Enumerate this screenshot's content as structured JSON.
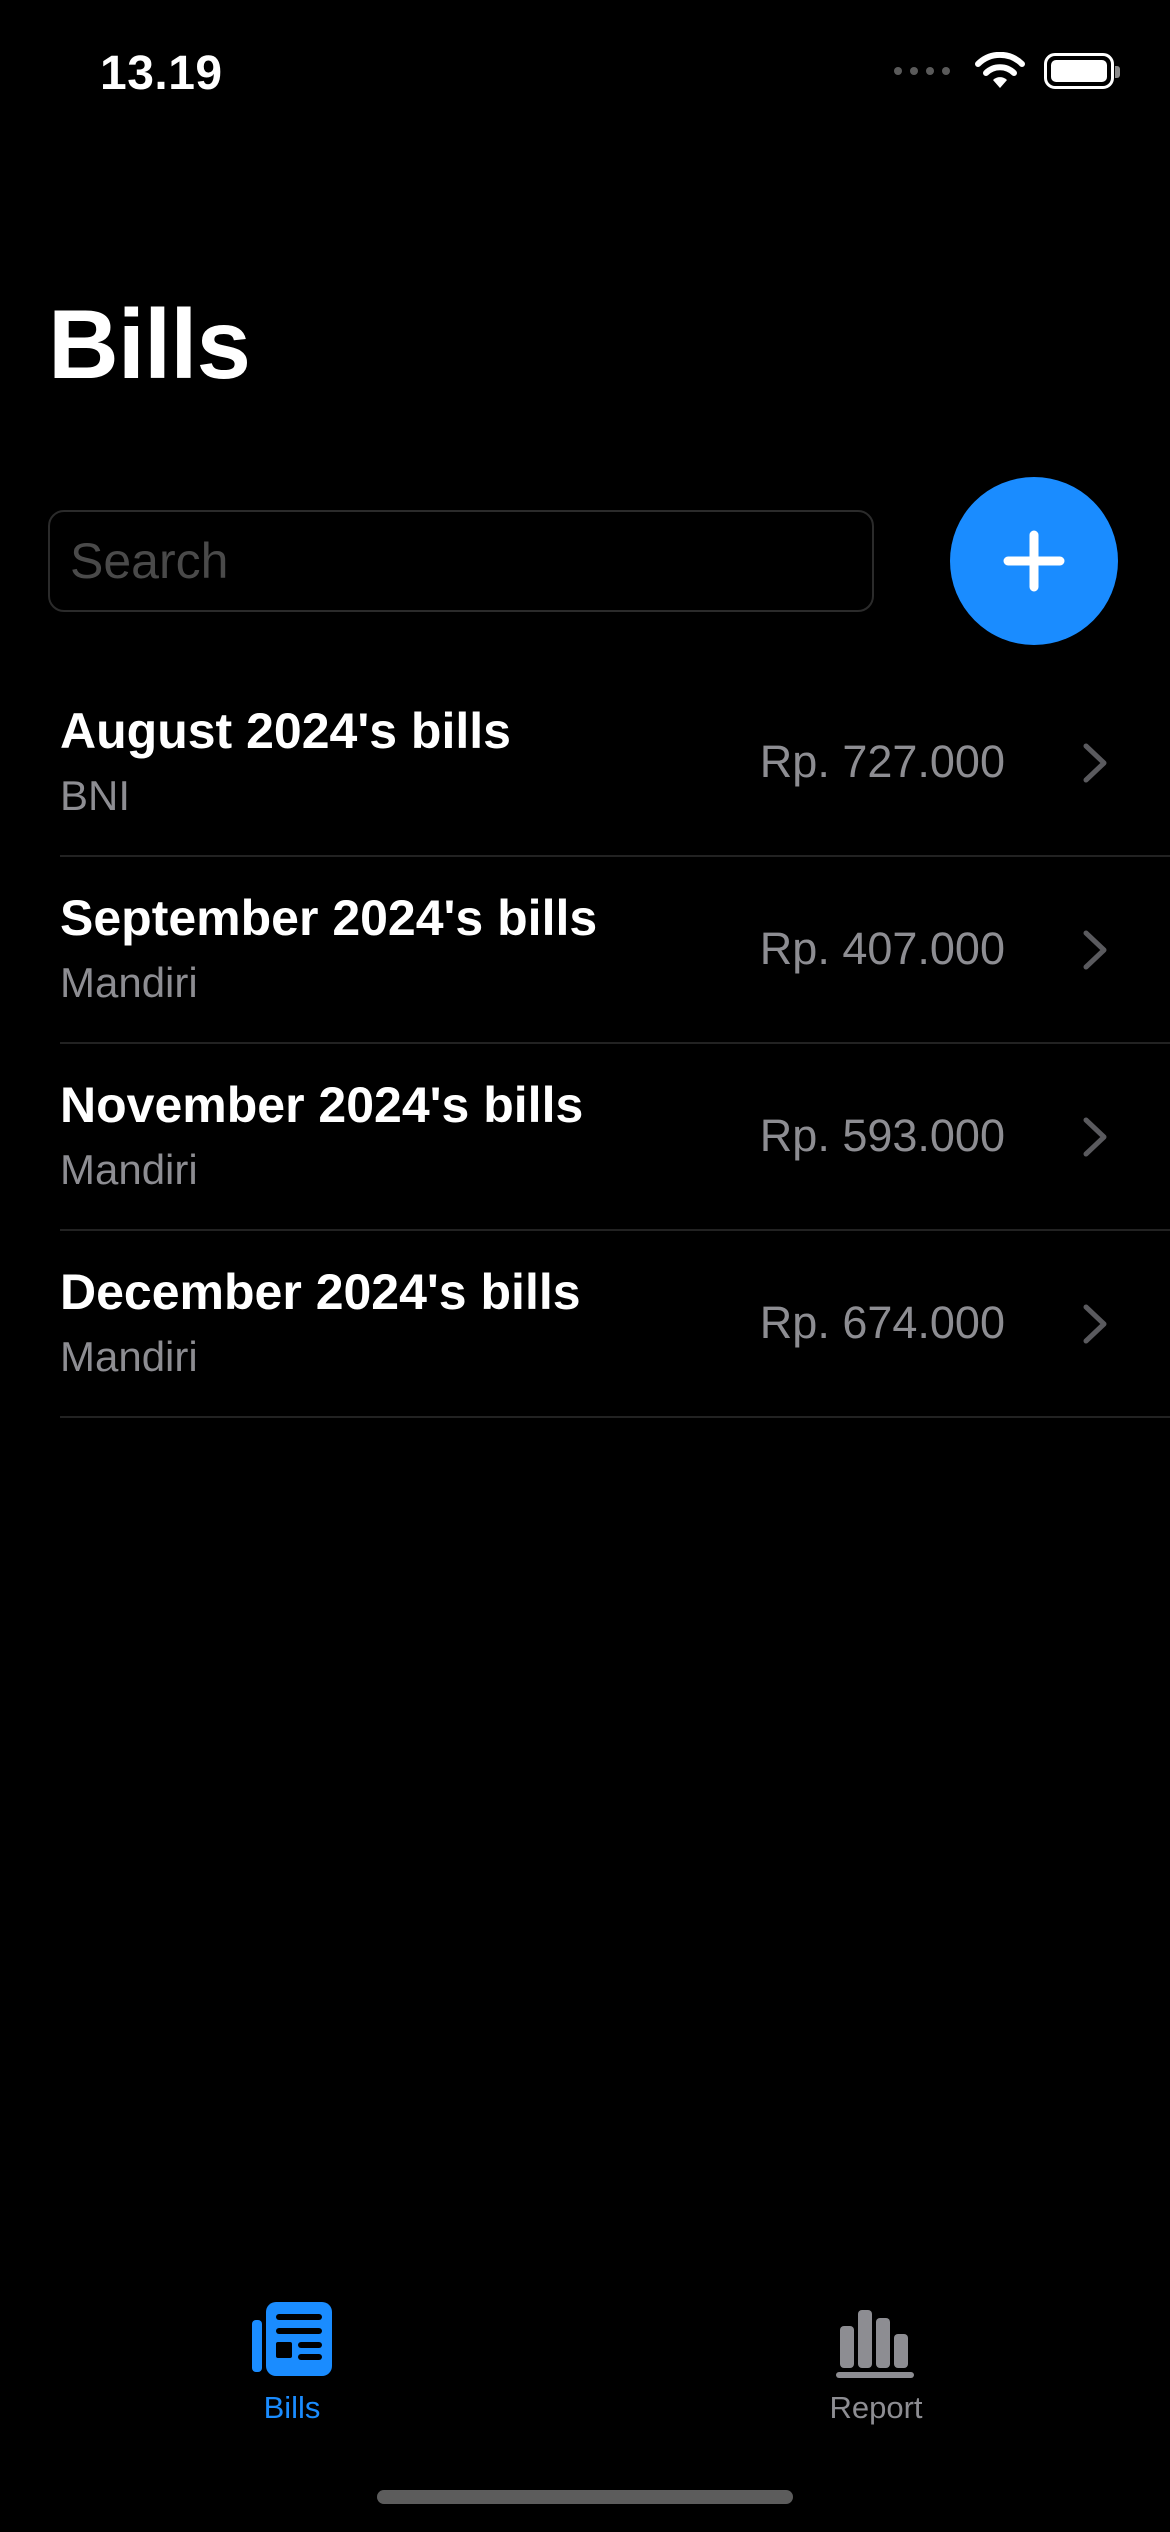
{
  "status_bar": {
    "time": "13.19"
  },
  "header": {
    "title": "Bills"
  },
  "search": {
    "placeholder": "Search",
    "value": ""
  },
  "add_button": {
    "icon": "plus-icon",
    "color": "#1a8cff"
  },
  "bills": [
    {
      "title": "August 2024's bills",
      "bank": "BNI",
      "amount": "Rp. 727.000"
    },
    {
      "title": "September 2024's bills",
      "bank": "Mandiri",
      "amount": "Rp. 407.000"
    },
    {
      "title": "November 2024's bills",
      "bank": "Mandiri",
      "amount": "Rp. 593.000"
    },
    {
      "title": "December 2024's bills",
      "bank": "Mandiri",
      "amount": "Rp. 674.000"
    }
  ],
  "tabs": [
    {
      "label": "Bills",
      "icon": "bills-list-icon",
      "selected": true
    },
    {
      "label": "Report",
      "icon": "bar-chart-icon",
      "selected": false
    }
  ],
  "colors": {
    "accent": "#1a8cff",
    "background": "#000000",
    "secondary_text": "#8d8d92"
  }
}
